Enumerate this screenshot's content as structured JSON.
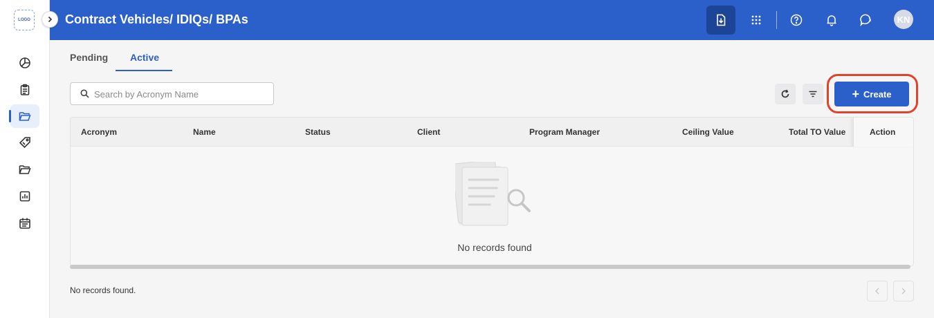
{
  "app": {
    "logo_text": "LOGO",
    "page_title": "Contract Vehicles/ IDIQs/ BPAs"
  },
  "sidebar": {
    "items": [
      {
        "name": "dashboard",
        "icon": "pie-chart-icon"
      },
      {
        "name": "tasks",
        "icon": "clipboard-icon"
      },
      {
        "name": "contract-vehicles",
        "icon": "folder-open-icon",
        "active": true
      },
      {
        "name": "tags",
        "icon": "tag-icon"
      },
      {
        "name": "documents",
        "icon": "folder-icon"
      },
      {
        "name": "reports",
        "icon": "bar-chart-icon"
      },
      {
        "name": "calendar",
        "icon": "calendar-icon"
      }
    ]
  },
  "header": {
    "avatar_initials": "KN",
    "icons": [
      "download-icon",
      "apps-grid-icon",
      "help-icon",
      "bell-icon",
      "chat-icon"
    ]
  },
  "tabs": [
    {
      "label": "Pending",
      "active": false
    },
    {
      "label": "Active",
      "active": true
    }
  ],
  "search": {
    "value": "",
    "placeholder": "Search by Acronym Name"
  },
  "toolbar": {
    "create_label": "Create"
  },
  "table": {
    "columns": [
      "Acronym",
      "Name",
      "Status",
      "Client",
      "Program Manager",
      "Ceiling Value",
      "Total TO Value",
      "Action"
    ],
    "rows": [],
    "empty_message": "No records found"
  },
  "footer": {
    "summary": "No records found."
  },
  "colors": {
    "brand": "#2b5fc9",
    "highlight_ring": "#e0432b"
  }
}
